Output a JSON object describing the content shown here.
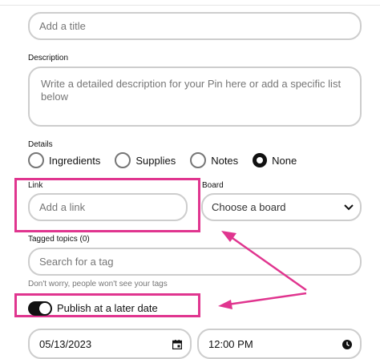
{
  "title": {
    "placeholder": "Add a title"
  },
  "description": {
    "label": "Description",
    "placeholder": "Write a detailed description for your Pin here or add a specific list below"
  },
  "details": {
    "label": "Details",
    "options": [
      "Ingredients",
      "Supplies",
      "Notes",
      "None"
    ],
    "selected": "None"
  },
  "link": {
    "label": "Link",
    "placeholder": "Add a link"
  },
  "board": {
    "label": "Board",
    "value": "Choose a board"
  },
  "tags": {
    "label": "Tagged topics (0)",
    "placeholder": "Search for a tag",
    "hint": "Don't worry, people won't see your tags"
  },
  "publish": {
    "label": "Publish at a later date",
    "on": true
  },
  "schedule": {
    "date": "05/13/2023",
    "time": "12:00 PM"
  },
  "colors": {
    "annotation": "#e0358f",
    "border": "#cdcdcd",
    "placeholder": "#767676"
  },
  "icons": [
    "chevron-down-icon",
    "calendar-icon",
    "clock-icon"
  ]
}
